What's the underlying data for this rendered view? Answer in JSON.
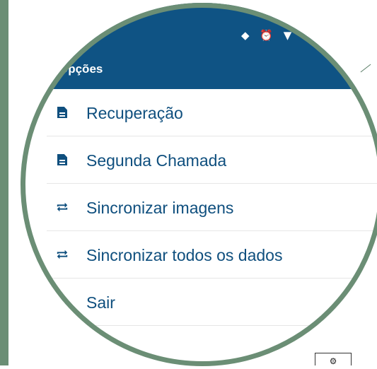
{
  "app_bar": {
    "title": "Opções"
  },
  "status_bar": {
    "icons_glyphs": "◆ ⏰ ▼"
  },
  "menu": {
    "items": [
      {
        "label": "Recuperação",
        "icon": "document-icon"
      },
      {
        "label": "Segunda Chamada",
        "icon": "document-icon"
      },
      {
        "label": "Sincronizar imagens",
        "icon": "sync-icon"
      },
      {
        "label": "Sincronizar todos os dados",
        "icon": "sync-icon"
      },
      {
        "label": "Sair",
        "icon": "power-icon"
      }
    ]
  },
  "colors": {
    "primary": "#0f5384",
    "menu_text": "#0f4f7e",
    "frame_green": "#6b8e75"
  },
  "corner_logo": {
    "glyph": "⚙"
  }
}
